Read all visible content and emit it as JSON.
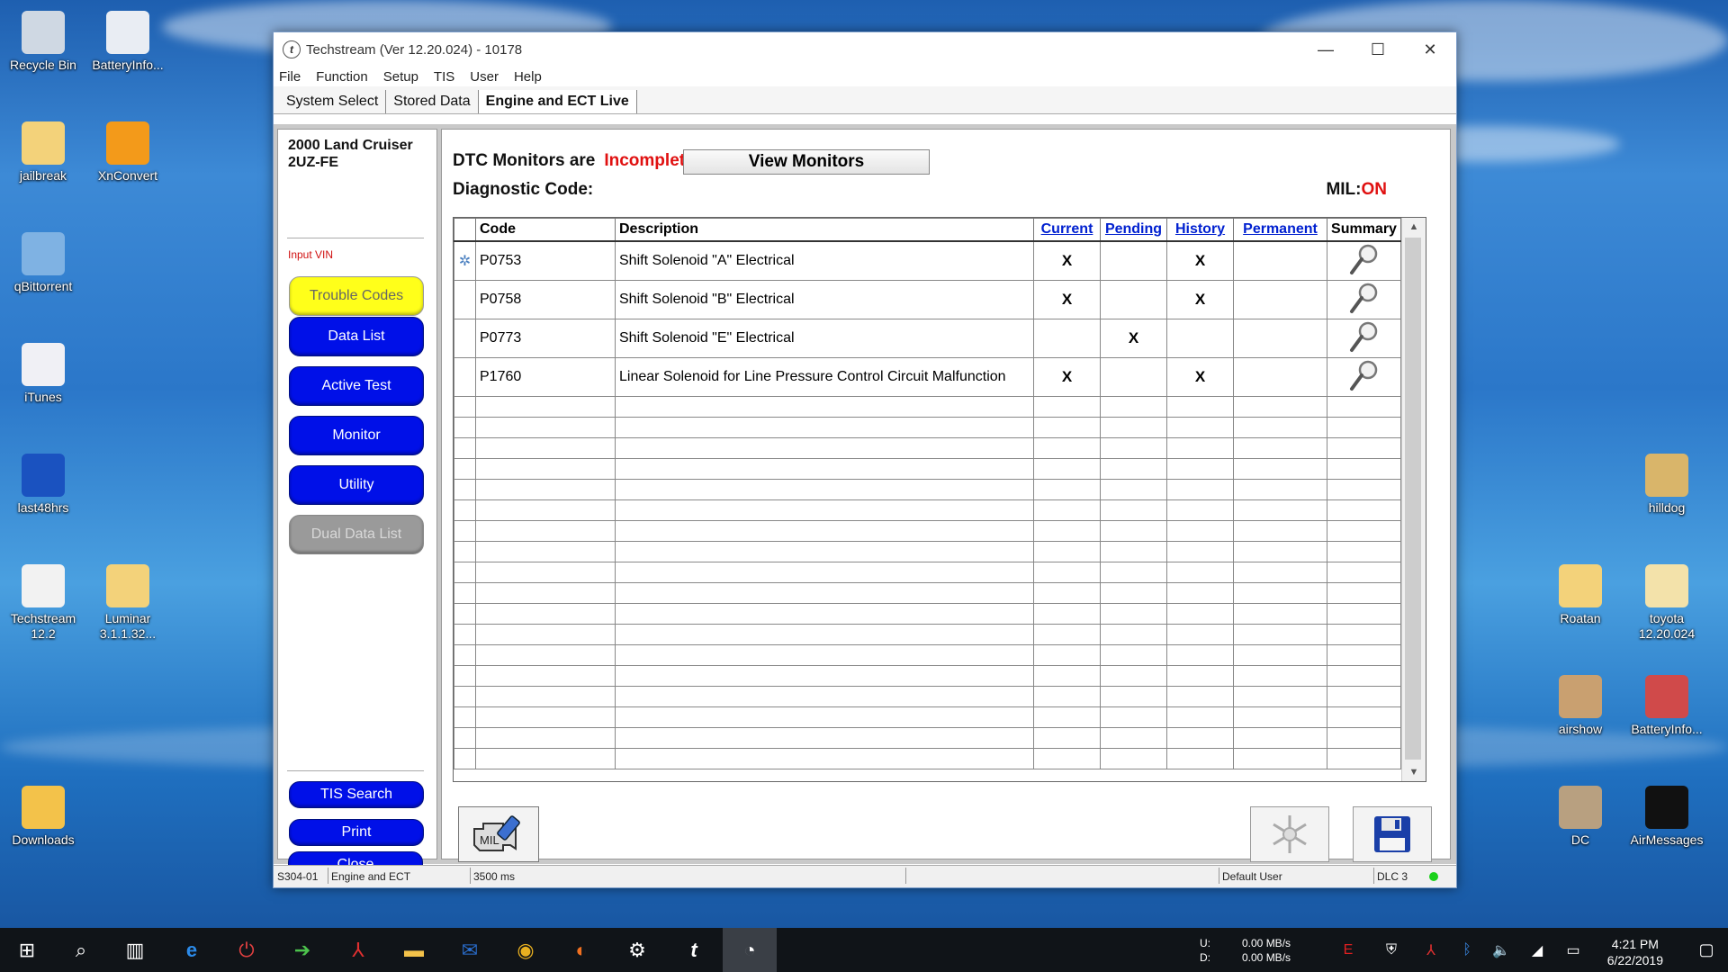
{
  "desktop": {
    "icons_left": [
      {
        "label": "Recycle Bin",
        "icon": "recycle-bin-icon",
        "color": "#cfd8e3"
      },
      {
        "label": "BatteryInfo...",
        "icon": "document-icon",
        "color": "#e9edf3"
      },
      {
        "label": "jailbreak",
        "icon": "folder-icon",
        "color": "#f3d27a"
      },
      {
        "label": "XnConvert",
        "icon": "xnconvert-icon",
        "color": "#f39a1a"
      },
      {
        "label": "qBittorrent",
        "icon": "qbittorrent-icon",
        "color": "#7fb2e3"
      },
      {
        "label": "iTunes",
        "icon": "itunes-icon",
        "color": "#f0f0f5"
      },
      {
        "label": "last48hrs",
        "icon": "globe-icon",
        "color": "#1a52c0"
      },
      {
        "label": "Techstream\n12.2",
        "icon": "techstream-icon",
        "color": "#f2f2f2"
      },
      {
        "label": "Luminar\n3.1.1.32...",
        "icon": "folder-icon",
        "color": "#f3d27a"
      },
      {
        "label": "Downloads",
        "icon": "downloads-folder-icon",
        "color": "#f3c24a"
      }
    ],
    "icons_right": [
      {
        "label": "hilldog",
        "icon": "folder-icon",
        "color": "#d9b56a"
      },
      {
        "label": "Roatan",
        "icon": "folder-icon",
        "color": "#f3d27a"
      },
      {
        "label": "toyota\n12.20.024",
        "icon": "folder-icon",
        "color": "#f3e2aa"
      },
      {
        "label": "airshow",
        "icon": "folder-icon",
        "color": "#c9a070"
      },
      {
        "label": "BatteryInfo...",
        "icon": "battery-icon",
        "color": "#d04a4a"
      },
      {
        "label": "DC",
        "icon": "folder-icon",
        "color": "#b8a080"
      },
      {
        "label": "AirMessages",
        "icon": "airmessages-icon",
        "color": "#111111"
      }
    ]
  },
  "window": {
    "title": "Techstream (Ver 12.20.024) - 10178",
    "menu": [
      "File",
      "Function",
      "Setup",
      "TIS",
      "User",
      "Help"
    ],
    "tabs": [
      "System Select",
      "Stored Data",
      "Engine and ECT Live"
    ],
    "active_tab": 2
  },
  "left_panel": {
    "vehicle_line1": "2000 Land Cruiser",
    "vehicle_line2": "2UZ-FE",
    "input_vin": "Input VIN",
    "buttons": [
      "Trouble Codes",
      "Data List",
      "Active Test",
      "Monitor",
      "Utility",
      "Dual Data List"
    ],
    "bottom_buttons": [
      "TIS Search",
      "Print",
      "Close"
    ]
  },
  "main": {
    "dtc_label": "DTC Monitors are",
    "dtc_status": "Incomplete.",
    "view_monitors": "View Monitors",
    "diag_label": "Diagnostic Code:",
    "mil_label": "MIL:",
    "mil_value": "ON",
    "columns": [
      "Code",
      "Description",
      "Current",
      "Pending",
      "History",
      "Permanent",
      "Summary"
    ],
    "rows": [
      {
        "code": "P0753",
        "desc": "Shift Solenoid \"A\" Electrical",
        "current": "X",
        "pending": "",
        "history": "X",
        "permanent": ""
      },
      {
        "code": "P0758",
        "desc": "Shift Solenoid \"B\" Electrical",
        "current": "X",
        "pending": "",
        "history": "X",
        "permanent": ""
      },
      {
        "code": "P0773",
        "desc": "Shift Solenoid \"E\" Electrical",
        "current": "",
        "pending": "X",
        "history": "",
        "permanent": ""
      },
      {
        "code": "P1760",
        "desc": "Linear Solenoid for Line Pressure Control Circuit Malfunction",
        "current": "X",
        "pending": "",
        "history": "X",
        "permanent": ""
      }
    ],
    "mil_button_text": "MIL"
  },
  "statusbar": {
    "code": "S304-01",
    "system": "Engine and ECT",
    "interval": "3500 ms",
    "user": "Default User",
    "dlc": "DLC 3"
  },
  "taskbar": {
    "net_u_label": "U:",
    "net_u": "0.00 MB/s",
    "net_d_label": "D:",
    "net_d": "0.00 MB/s",
    "time": "4:21 PM",
    "date": "6/22/2019"
  }
}
